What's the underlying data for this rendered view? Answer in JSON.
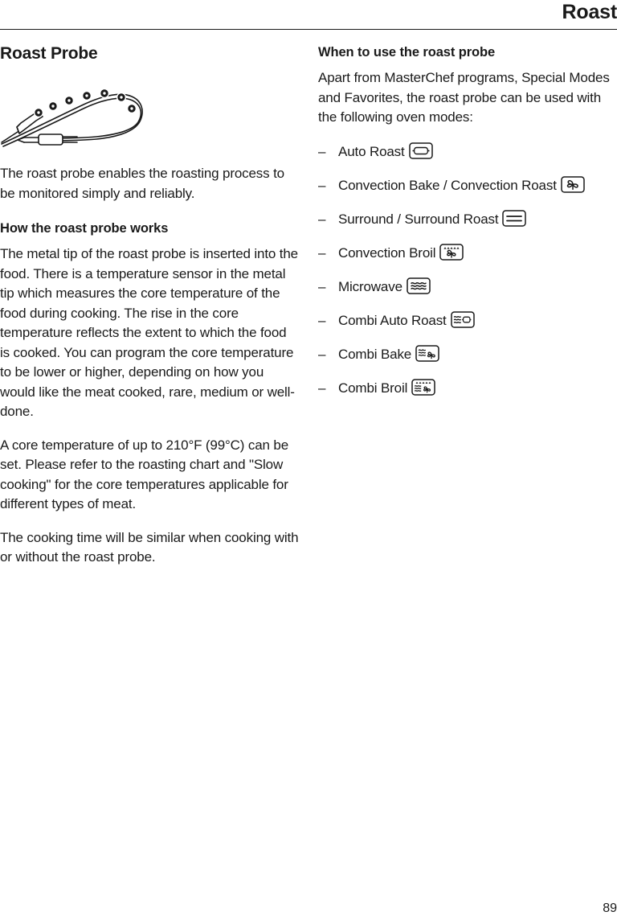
{
  "header": {
    "title": "Roast"
  },
  "left_column": {
    "section_title": "Roast Probe",
    "figure_name": "roast-probe-illustration",
    "intro_paragraph": "The roast probe enables the roasting process to be monitored simply and reliably.",
    "how_it_works_heading": "How the roast probe works",
    "how_it_works_paragraph": "The metal tip of the roast probe is inserted into the food. There is a temperature sensor in the metal tip which measures the core temperature of the food during cooking. The rise in the core temperature reflects the extent to which the food is cooked. You can program the core temperature to be lower or higher, depending on how you would like the meat cooked, rare, medium or well-done.",
    "core_temp_paragraph": "A core temperature of up to 210°F (99°C) can be set. Please refer to the roasting chart and \"Slow cooking\" for the core temperatures applicable for different types of meat.",
    "cooking_time_paragraph": "The cooking time will be similar when cooking with or without the roast probe."
  },
  "right_column": {
    "when_to_use_heading": "When to use the roast probe",
    "when_to_use_paragraph": "Apart from MasterChef programs, Special Modes and Favorites, the roast probe can be used with the following oven modes:",
    "bullet_dash": "–",
    "modes": [
      {
        "label": "Auto Roast",
        "icon": "auto-roast-icon"
      },
      {
        "label": "Convection Bake / Convection Roast",
        "icon": "convection-fan-icon"
      },
      {
        "label": "Surround / Surround Roast",
        "icon": "surround-icon"
      },
      {
        "label": "Convection Broil",
        "icon": "convection-broil-icon"
      },
      {
        "label": "Microwave",
        "icon": "microwave-icon"
      },
      {
        "label": "Combi Auto Roast",
        "icon": "combi-auto-roast-icon"
      },
      {
        "label": "Combi Bake",
        "icon": "combi-bake-icon"
      },
      {
        "label": "Combi Broil",
        "icon": "combi-broil-icon"
      }
    ]
  },
  "footer": {
    "page_number": "89"
  },
  "colors": {
    "ink": "#1a1a1a",
    "background": "#ffffff"
  }
}
